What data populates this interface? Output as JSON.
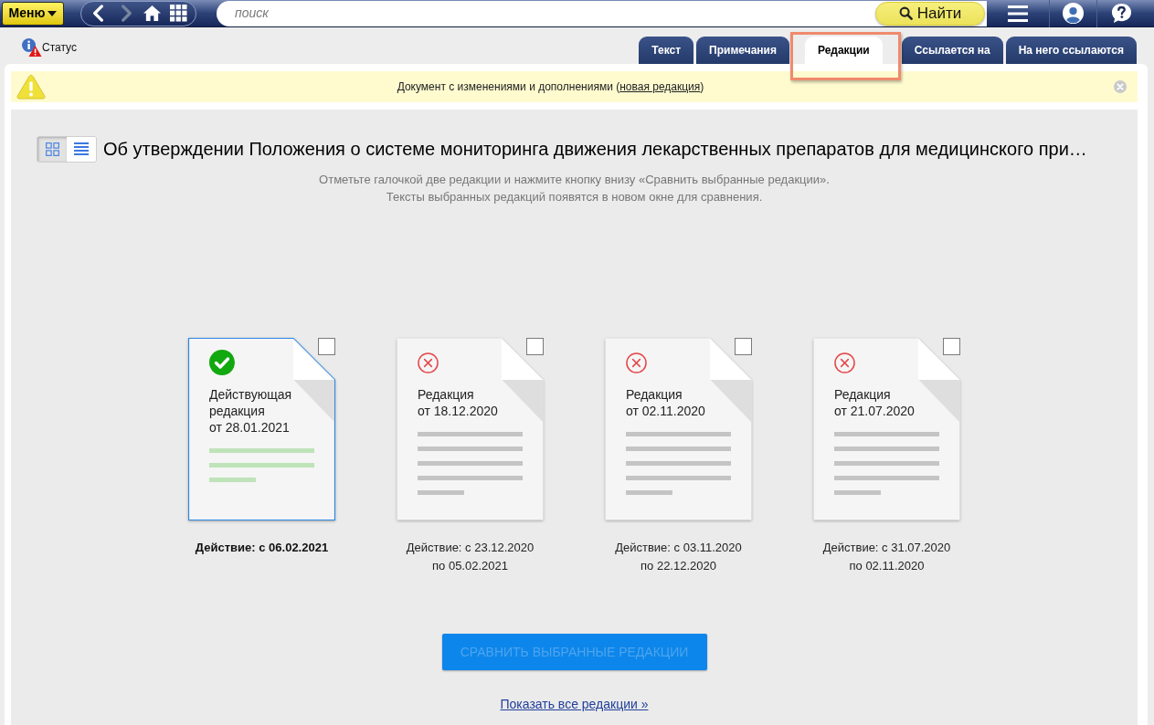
{
  "toolbar": {
    "menu_button": "Меню",
    "nav": [
      {
        "kind": "back",
        "disabled": false
      },
      {
        "kind": "forward",
        "disabled": true
      },
      {
        "kind": "home",
        "disabled": false
      },
      {
        "kind": "apps",
        "disabled": false
      }
    ],
    "search": {
      "placeholder": "поиск"
    },
    "find_button": "Найти"
  },
  "status": {
    "label": "Статус"
  },
  "tabs": [
    {
      "label": "Текст",
      "selected": false
    },
    {
      "label": "Примечания",
      "selected": false
    },
    {
      "label": "Редакции",
      "selected": true
    },
    {
      "label": "Ссылается на",
      "selected": false
    },
    {
      "label": "На него ссылаются",
      "selected": false
    }
  ],
  "notice": {
    "before": "Документ с изменениями и дополнениями (",
    "link": "новая редакция",
    "after": ")"
  },
  "document": {
    "view_modes": [
      {
        "kind": "grid",
        "selected": true
      },
      {
        "kind": "list",
        "selected": false
      }
    ],
    "title": "Об утверждении Положения о системе мониторинга движения лекарственных препаратов для медицинского при…",
    "hint": [
      "Отметьте галочкой две редакции и нажмите кнопку внизу «Сравнить выбранные редакции».",
      "Тексты выбранных редакций появятся в новом окне для сравнения."
    ]
  },
  "editions": [
    {
      "kind": "current",
      "checked": false,
      "label": [
        "Действующая",
        "редакция",
        "от 28.01.2021"
      ],
      "period": [
        "Действие: с 06.02.2021"
      ]
    },
    {
      "kind": "past",
      "checked": false,
      "label": [
        "Редакция",
        "от 18.12.2020"
      ],
      "period": [
        "Действие: с 23.12.2020",
        "по 05.02.2021"
      ]
    },
    {
      "kind": "past",
      "checked": false,
      "label": [
        "Редакция",
        "от 02.11.2020"
      ],
      "period": [
        "Действие: с 03.11.2020",
        "по 22.12.2020"
      ]
    },
    {
      "kind": "past",
      "checked": false,
      "label": [
        "Редакция",
        "от 21.07.2020"
      ],
      "period": [
        "Действие: с 31.07.2020",
        "по 02.11.2020"
      ]
    }
  ],
  "compare_button": {
    "label": "СРАВНИТЬ ВЫБРАННЫЕ РЕДАКЦИИ",
    "disabled": true
  },
  "show_all_link": "Показать все редакции »"
}
